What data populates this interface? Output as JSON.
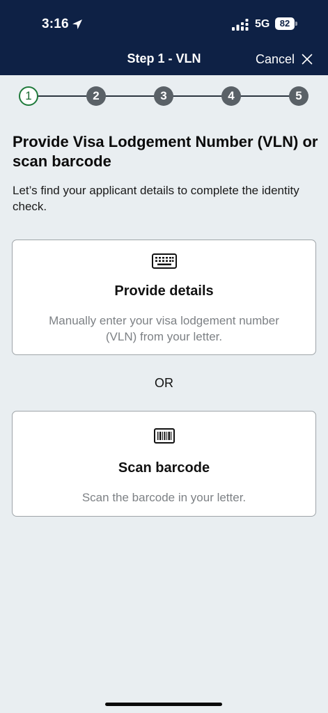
{
  "status_bar": {
    "time": "3:16",
    "network": "5G",
    "battery": "82"
  },
  "nav": {
    "title": "Step 1 - VLN",
    "cancel_label": "Cancel"
  },
  "stepper": {
    "steps": [
      "1",
      "2",
      "3",
      "4",
      "5"
    ],
    "active_index": 0
  },
  "content": {
    "heading": "Provide Visa Lodgement Number (VLN) or scan barcode",
    "intro": "Let’s find your applicant details to complete the identity check.",
    "or_label": "OR"
  },
  "cards": {
    "provide": {
      "icon": "keyboard-icon",
      "title": "Provide details",
      "description": "Manually enter your visa lodgement number (VLN) from your letter."
    },
    "scan": {
      "icon": "barcode-icon",
      "title": "Scan barcode",
      "description": "Scan the barcode in your letter."
    }
  },
  "colors": {
    "header_bg": "#0e2145",
    "page_bg": "#e9eef1",
    "active_step": "#1f7a3b",
    "inactive_step": "#5a6167"
  }
}
